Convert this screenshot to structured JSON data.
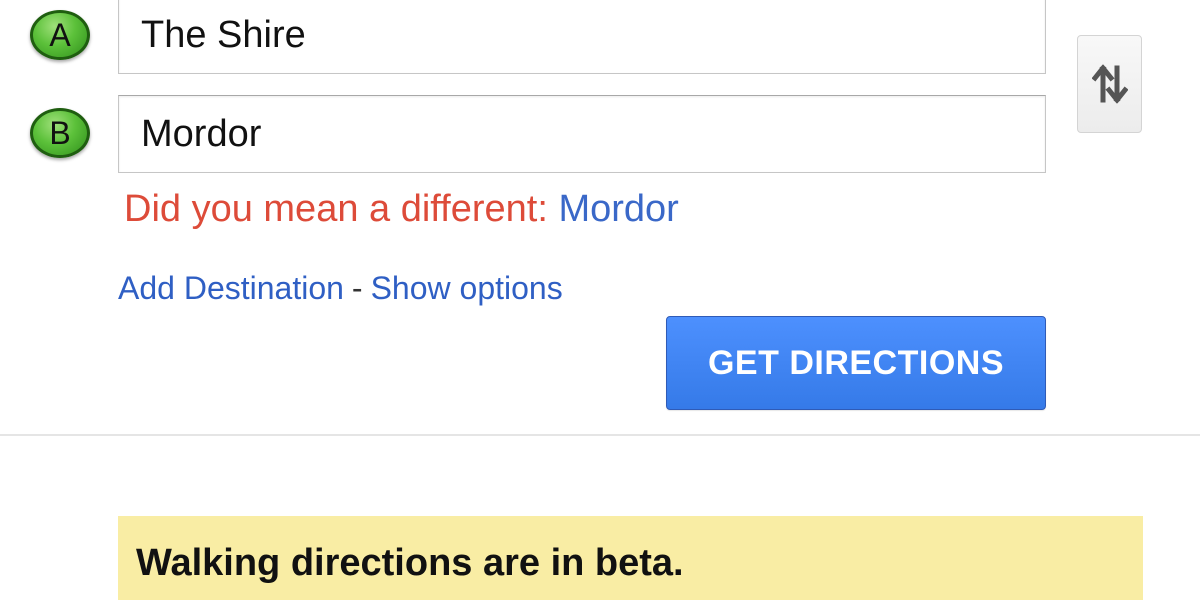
{
  "route": {
    "start": {
      "marker_label": "A",
      "value": "The Shire"
    },
    "end": {
      "marker_label": "B",
      "value": "Mordor"
    }
  },
  "swap_button": {
    "icon": "swap-vertical-icon"
  },
  "suggestion": {
    "prefix": "Did you mean a different:",
    "link": "Mordor",
    "prefix_color": "#dd4b39",
    "link_color": "#3a68c8"
  },
  "links": {
    "add_destination": "Add Destination",
    "separator": "-",
    "show_options": "Show options"
  },
  "get_directions": {
    "label": "GET DIRECTIONS",
    "color": "#4d90fe"
  },
  "notice": {
    "text": "Walking directions are in beta.",
    "background": "#f9eda4"
  }
}
